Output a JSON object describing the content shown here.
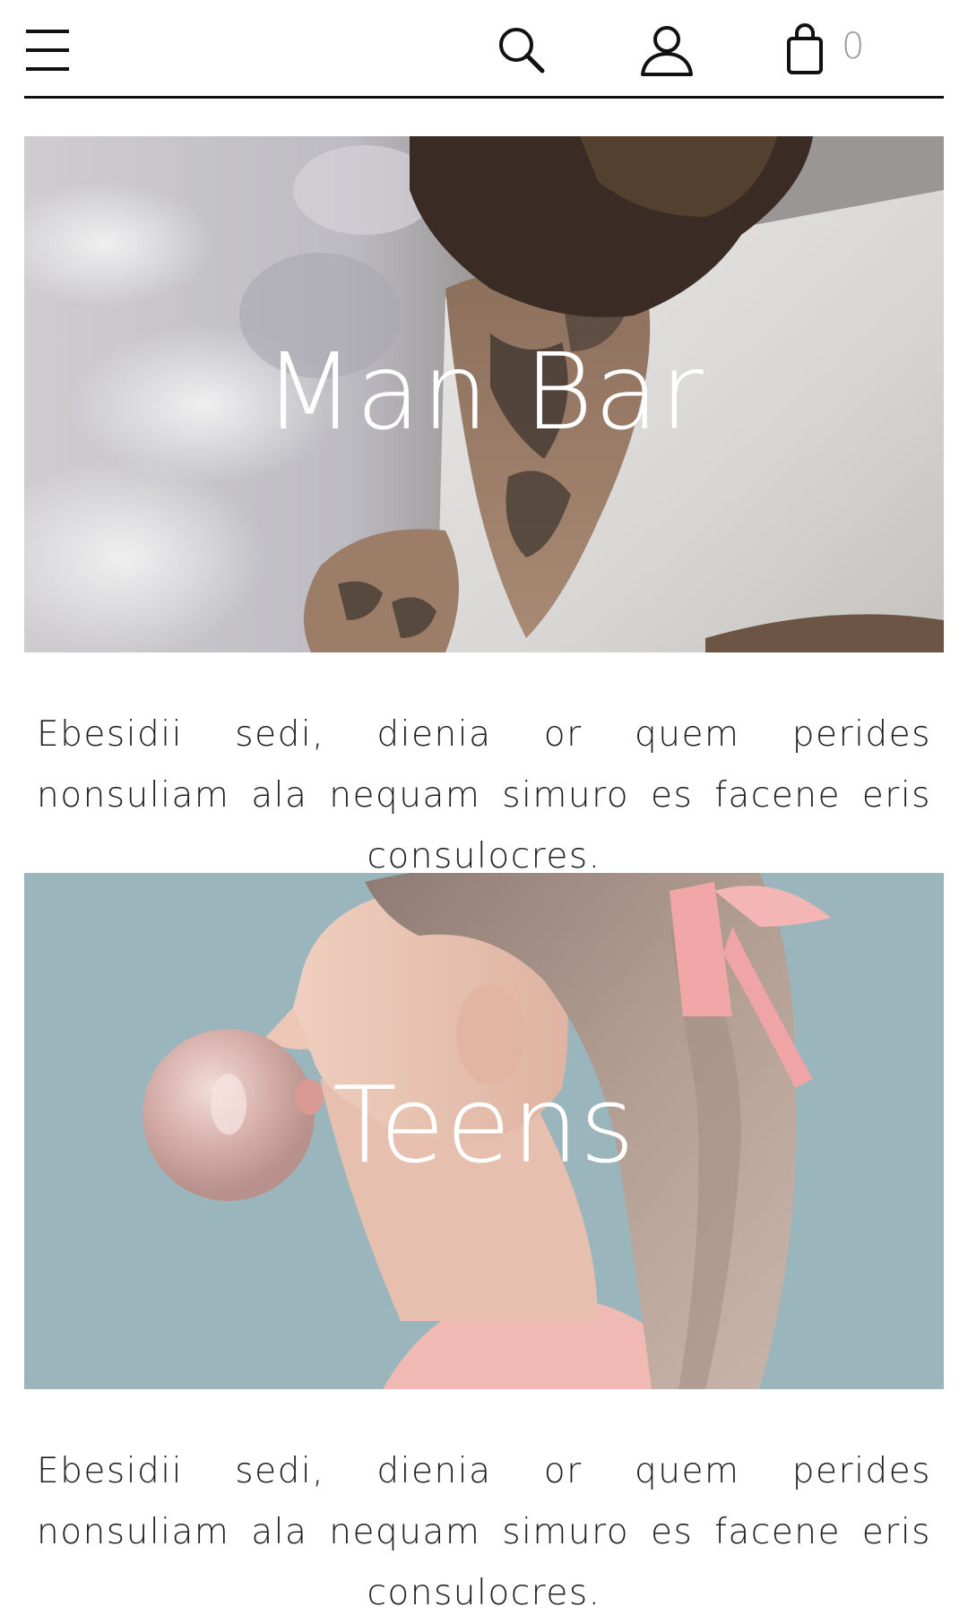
{
  "header": {
    "menu_icon": "hamburger-menu-icon",
    "search_icon": "search-icon",
    "account_icon": "user-icon",
    "cart_icon": "shopping-bag-icon",
    "cart_count": "0"
  },
  "categories": [
    {
      "title": "Man Bar",
      "description": "Ebesidii sedi, dienia or quem perides nonsuliam ala nequam simuro es facene eris consulocres.",
      "image": "man-tattoo-photo"
    },
    {
      "title": "Teens",
      "description": "Ebesidii sedi, dienia or quem perides nonsuliam ala nequam simuro es facene eris consulocres.",
      "image": "girl-bubblegum-photo"
    }
  ],
  "colors": {
    "header_border": "#111111",
    "cart_count": "#9a9a9a",
    "teens_background": "#9bb5bc",
    "text": "#1f1f1f"
  }
}
